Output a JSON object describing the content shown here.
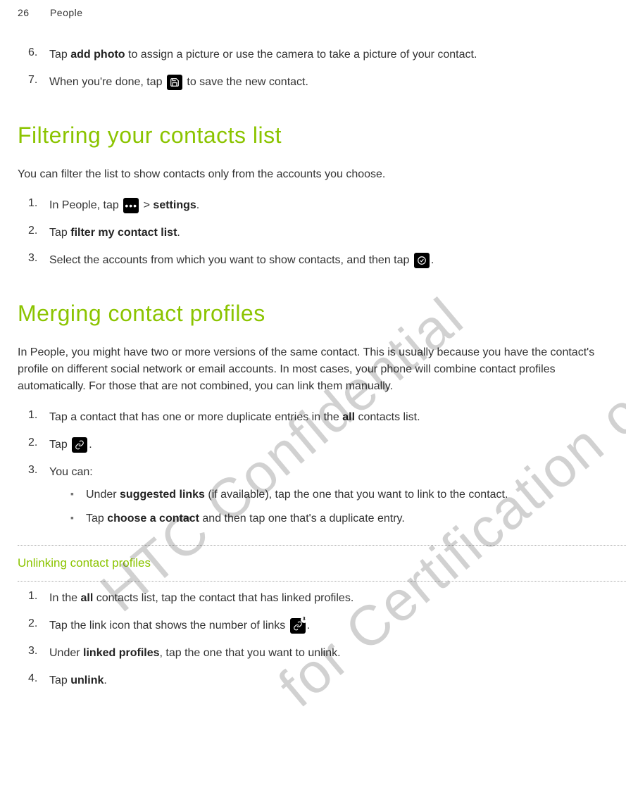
{
  "header": {
    "page_num": "26",
    "section": "People"
  },
  "cont_steps": {
    "s6": {
      "num": "6.",
      "pre": "Tap ",
      "bold": "add photo",
      "post": " to assign a picture or use the camera to take a picture of your contact."
    },
    "s7": {
      "num": "7.",
      "pre": "When you're done, tap ",
      "post": " to save the new contact."
    }
  },
  "filter": {
    "title": "Filtering your contacts list",
    "lead": "You can filter the list to show contacts only from the accounts you choose.",
    "s1": {
      "num": "1.",
      "pre": "In People, tap ",
      "mid": " > ",
      "bold": "settings",
      "post": "."
    },
    "s2": {
      "num": "2.",
      "pre": "Tap ",
      "bold": "filter my contact list",
      "post": "."
    },
    "s3": {
      "num": "3.",
      "pre": "Select the accounts from which you want to show contacts, and then tap ",
      "post": "."
    }
  },
  "merge": {
    "title": "Merging contact profiles",
    "lead": "In People, you might have two or more versions of the same contact. This is usually because you have the contact's profile on different social network or email accounts. In most cases, your phone will combine contact profiles automatically. For those that are not combined, you can link them manually.",
    "s1": {
      "num": "1.",
      "pre": "Tap a contact that has one or more duplicate entries in the ",
      "bold": "all",
      "post": " contacts list."
    },
    "s2": {
      "num": "2.",
      "pre": "Tap ",
      "post": "."
    },
    "s3": {
      "num": "3.",
      "pre": "You can:"
    },
    "b1": {
      "pre": "Under ",
      "bold": "suggested links",
      "post": " (if available), tap the one that you want to link to the contact."
    },
    "b2": {
      "pre": "Tap ",
      "bold": "choose a contact",
      "post": " and then tap one that's a duplicate entry."
    }
  },
  "unlink": {
    "title": "Unlinking contact profiles",
    "s1": {
      "num": "1.",
      "pre": "In the ",
      "bold": "all",
      "post": " contacts list, tap the contact that has linked profiles."
    },
    "s2": {
      "num": "2.",
      "pre": "Tap the link icon that shows the number of links ",
      "post": "."
    },
    "s3": {
      "num": "3.",
      "pre": "Under ",
      "bold": "linked profiles",
      "post": ", tap the one that you want to unlink."
    },
    "s4": {
      "num": "4.",
      "pre": "Tap ",
      "bold": "unlink",
      "post": "."
    }
  },
  "watermarks": {
    "w1": "HTC Confidential",
    "w2": "for Certification only"
  },
  "link_badge": "3"
}
